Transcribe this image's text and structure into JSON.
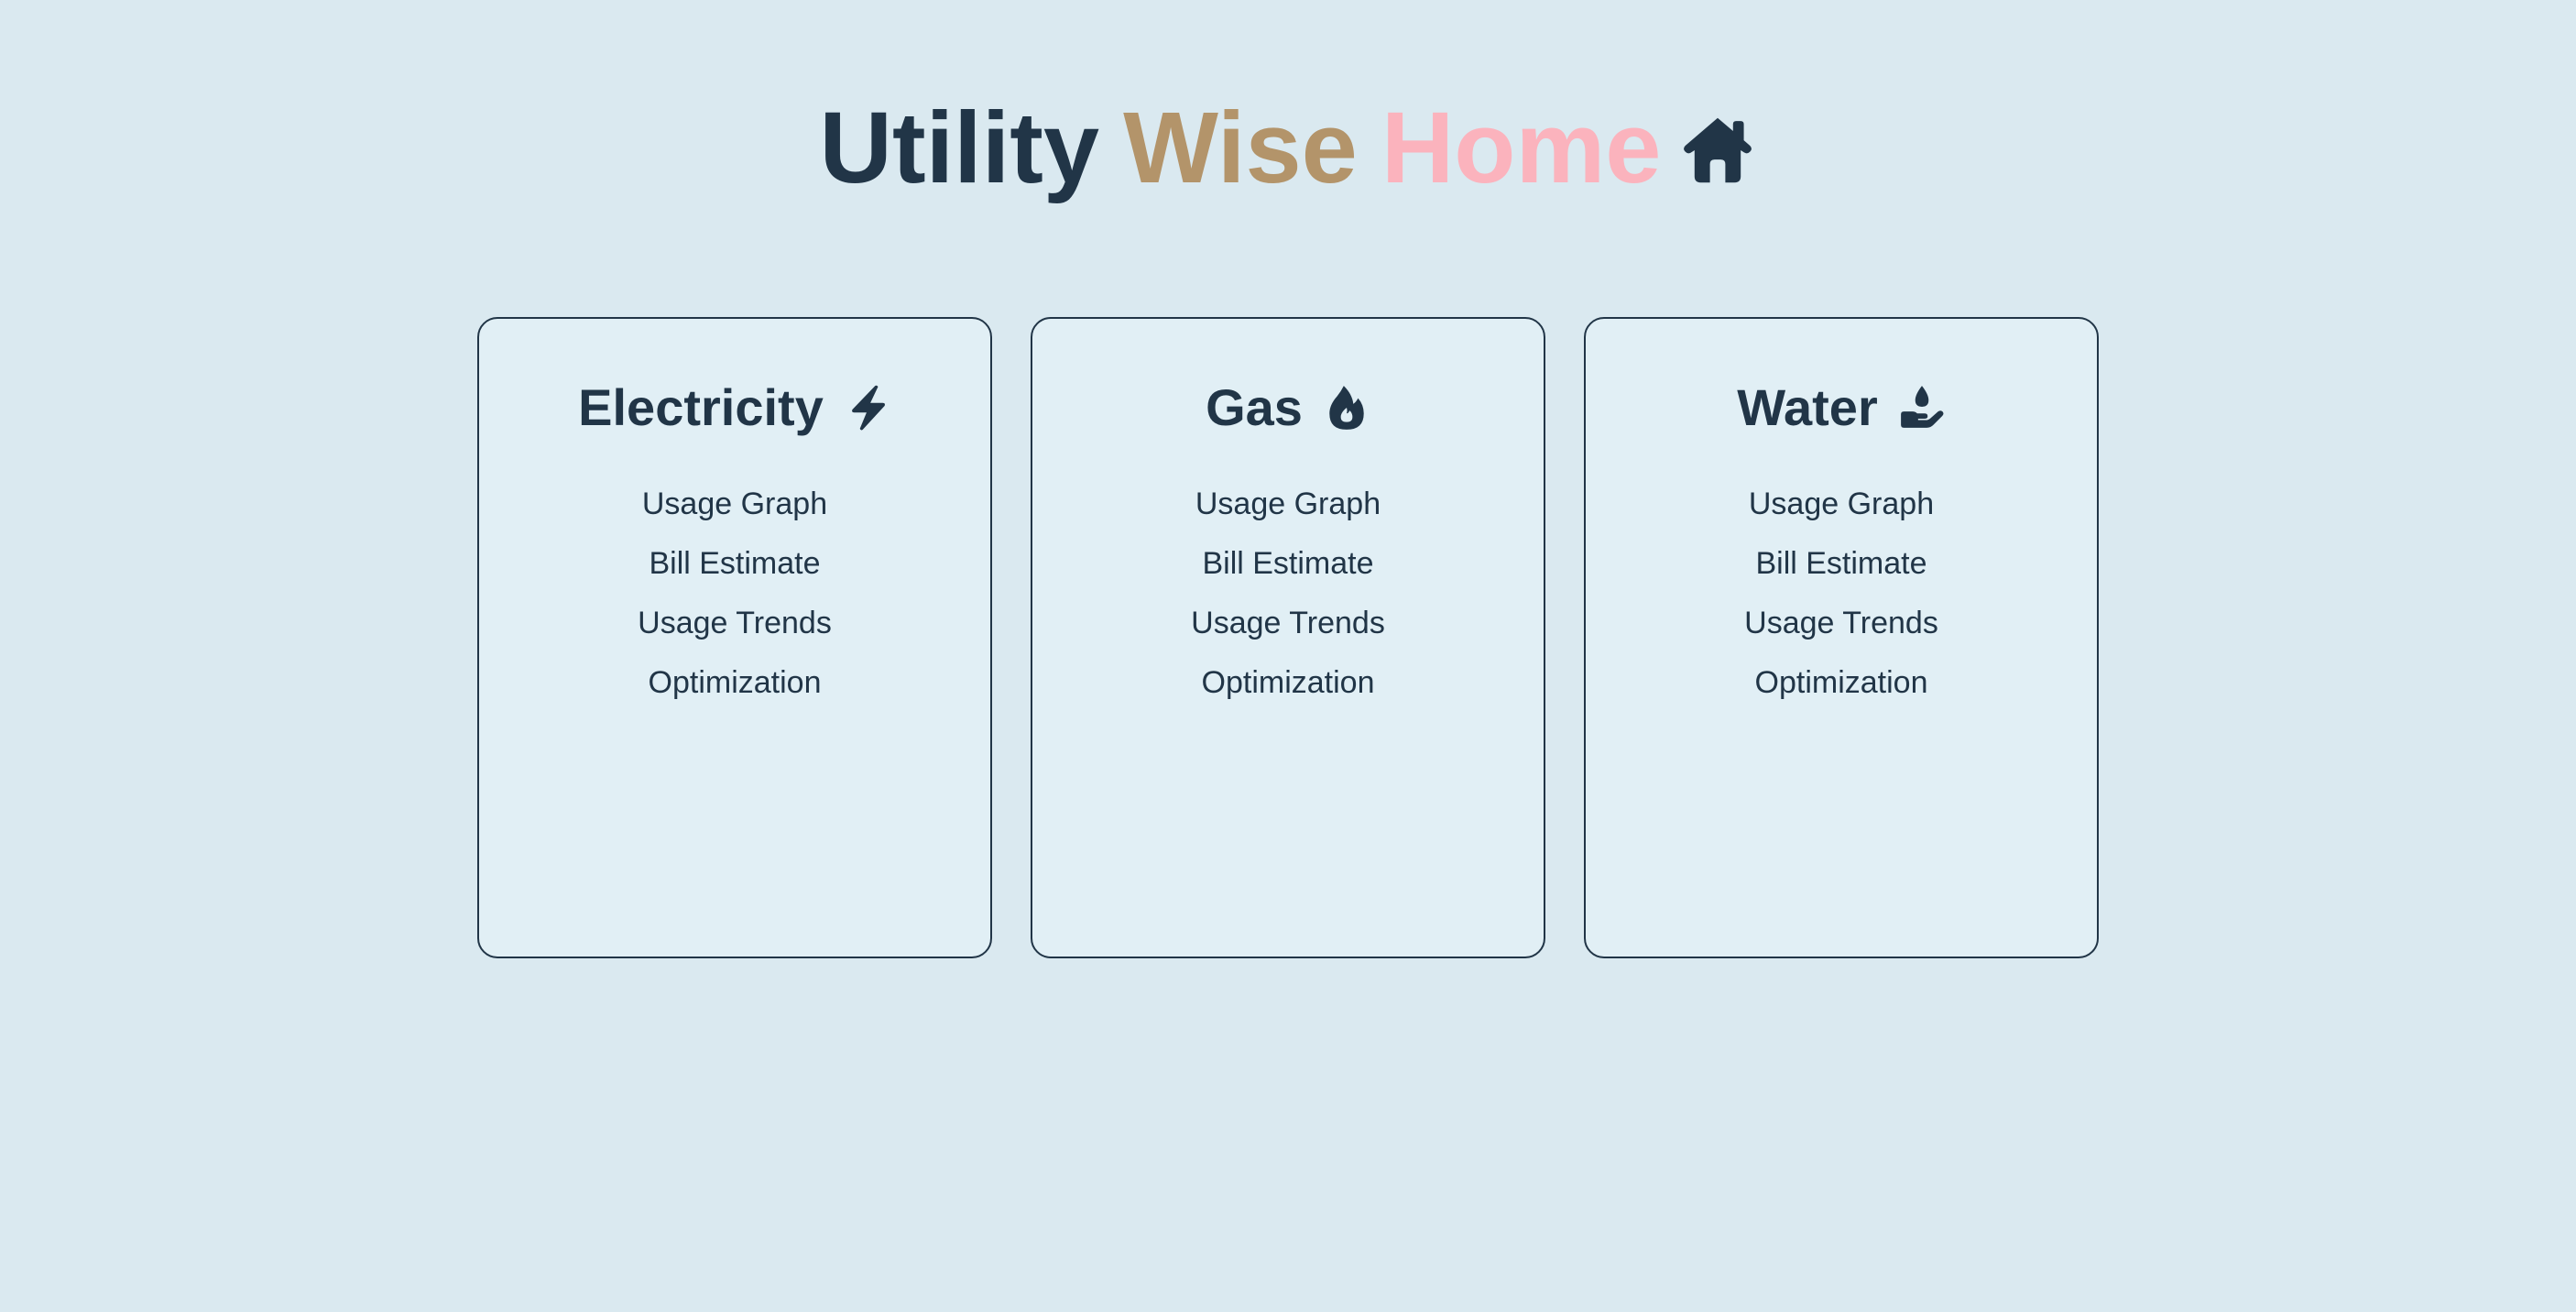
{
  "header": {
    "title_part1": "Utility",
    "title_part2": "Wise",
    "title_part3": "Home",
    "icon": "house-icon",
    "colors": {
      "part1": "#213547",
      "part2": "#b3946a",
      "part3": "#fbb3bd"
    }
  },
  "cards": [
    {
      "title": "Electricity",
      "icon": "lightning-bolt-icon",
      "items": [
        "Usage Graph",
        "Bill Estimate",
        "Usage Trends",
        "Optimization"
      ]
    },
    {
      "title": "Gas",
      "icon": "fire-flame-icon",
      "items": [
        "Usage Graph",
        "Bill Estimate",
        "Usage Trends",
        "Optimization"
      ]
    },
    {
      "title": "Water",
      "icon": "hand-holding-droplet-icon",
      "items": [
        "Usage Graph",
        "Bill Estimate",
        "Usage Trends",
        "Optimization"
      ]
    }
  ],
  "theme": {
    "background": "#dae9f0",
    "card_background": "#e1eff5",
    "text": "#213547"
  }
}
